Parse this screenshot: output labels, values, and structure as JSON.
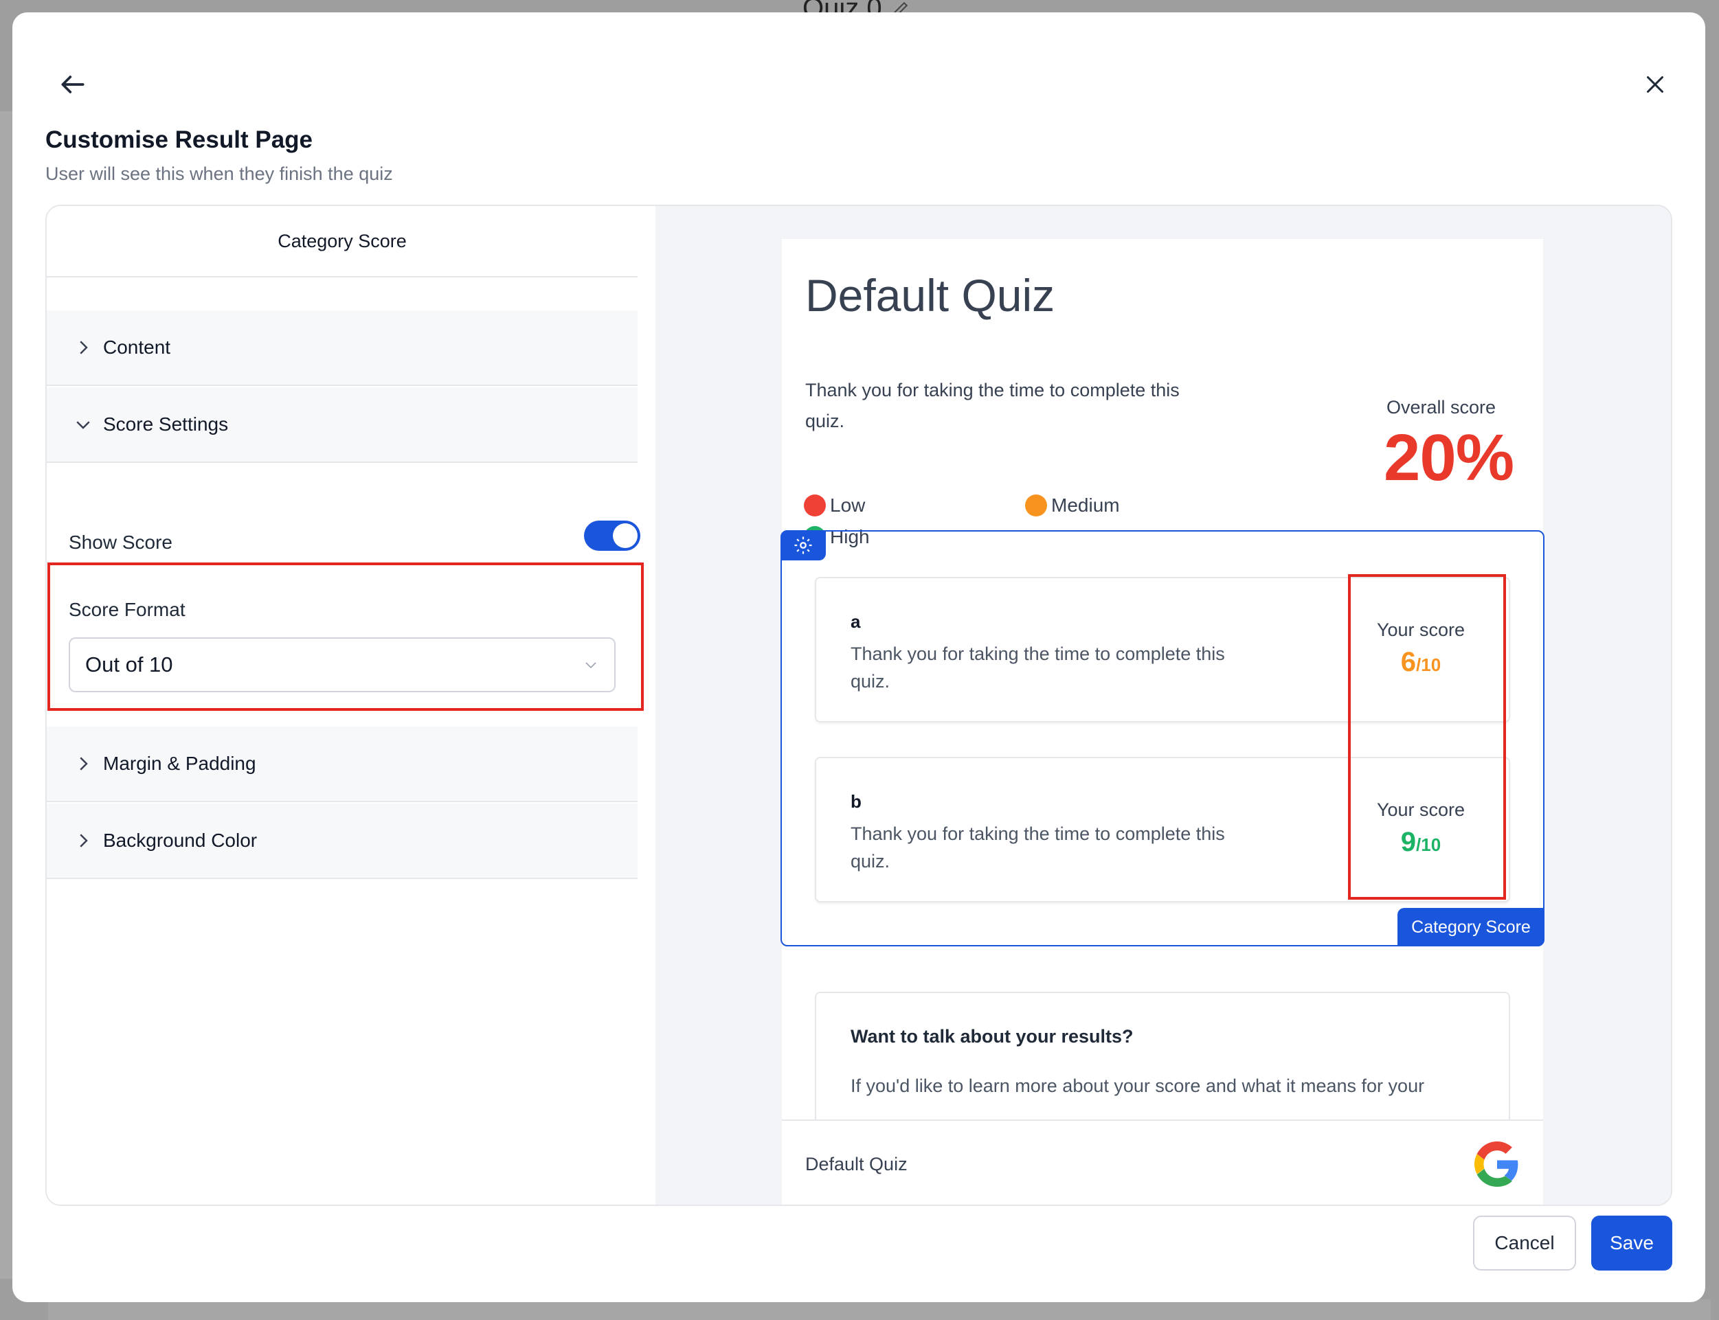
{
  "background_page": {
    "title": "Quiz 0"
  },
  "modal": {
    "title": "Customise Result Page",
    "subtitle": "User will see this when they finish the quiz"
  },
  "left_panel": {
    "header": "Category Score",
    "sections": {
      "content": "Content",
      "score_settings": "Score Settings",
      "margin_padding": "Margin & Padding",
      "background_color": "Background Color"
    },
    "show_score": {
      "label": "Show Score",
      "enabled": true
    },
    "score_format": {
      "label": "Score Format",
      "value": "Out of 10"
    }
  },
  "preview": {
    "quiz_title": "Default Quiz",
    "thanks_text": "Thank you for taking the time to complete this quiz.",
    "legend": [
      {
        "label": "Low",
        "color": "#ef4135"
      },
      {
        "label": "Medium",
        "color": "#f7931e"
      },
      {
        "label": "High",
        "color": "#1db366"
      }
    ],
    "overall": {
      "label": "Overall score",
      "value": "20%",
      "color": "#e8392a"
    },
    "category_tab_label": "Category Score",
    "categories": [
      {
        "name": "a",
        "description": "Thank you for taking the time to complete this quiz.",
        "score_label": "Your score",
        "score": "6",
        "max": "/10",
        "color": "#f7931e"
      },
      {
        "name": "b",
        "description": "Thank you for taking the time to complete this quiz.",
        "score_label": "Your score",
        "score": "9",
        "max": "/10",
        "color": "#1db366"
      }
    ],
    "talk": {
      "title": "Want to talk about your results?",
      "text": "If you'd like to learn more about your score and what it means for your"
    },
    "footer": {
      "name": "Default Quiz",
      "icon": "google-icon"
    }
  },
  "actions": {
    "cancel": "Cancel",
    "save": "Save"
  },
  "colors": {
    "accent": "#1a56db",
    "highlight": "#e3261f"
  }
}
